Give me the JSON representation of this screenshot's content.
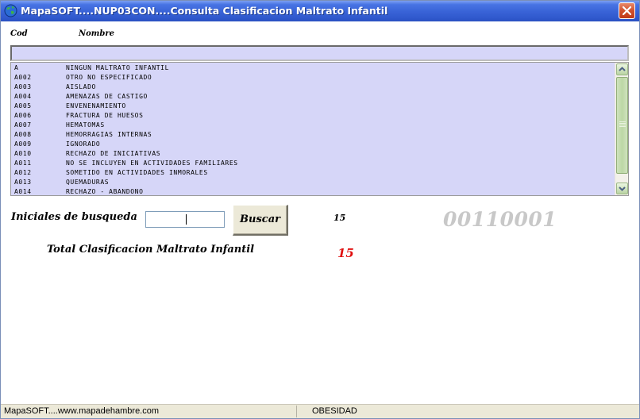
{
  "window": {
    "title": "MapaSOFT....NUP03CON....Consulta  Clasificacion Maltrato Infantil",
    "icon": "globe-icon",
    "close_icon": "close-icon"
  },
  "headers": {
    "code": "Cod",
    "name": "Nombre"
  },
  "search_bar_value": "",
  "list": {
    "rows": [
      {
        "code": "A",
        "name": "NINGUN MALTRATO INFANTIL"
      },
      {
        "code": "A002",
        "name": "OTRO NO ESPECIFICADO"
      },
      {
        "code": "A003",
        "name": "AISLADO"
      },
      {
        "code": "A004",
        "name": "AMENAZAS DE CASTIGO"
      },
      {
        "code": "A005",
        "name": "ENVENENAMIENTO"
      },
      {
        "code": "A006",
        "name": "FRACTURA DE HUESOS"
      },
      {
        "code": "A007",
        "name": "HEMATOMAS"
      },
      {
        "code": "A008",
        "name": "HEMORRAGIAS INTERNAS"
      },
      {
        "code": "A009",
        "name": "IGNORADO"
      },
      {
        "code": "A010",
        "name": "RECHAZO DE INICIATIVAS"
      },
      {
        "code": "A011",
        "name": "NO SE INCLUYEN EN ACTIVIDADES FAMILIARES"
      },
      {
        "code": "A012",
        "name": "SOMETIDO EN ACTIVIDADES INMORALES"
      },
      {
        "code": "A013",
        "name": "QUEMADURAS"
      },
      {
        "code": "A014",
        "name": "RECHAZO - ABANDONO"
      }
    ],
    "scroll_up_icon": "chevron-up-icon",
    "scroll_down_icon": "chevron-down-icon"
  },
  "search": {
    "label": "Iniciales de busqueda",
    "value": "",
    "button_label": "Buscar"
  },
  "record_count": "15",
  "record_code": "00110001",
  "total": {
    "label": "Total  Clasificacion Maltrato  Infantil",
    "value": "15"
  },
  "status": {
    "left": "MapaSOFT....www.mapadehambre.com",
    "middle": "OBESIDAD"
  },
  "colors": {
    "list_background": "#d6d6f8",
    "total_value": "#e01010",
    "code_watermark": "#c8c8c8"
  }
}
